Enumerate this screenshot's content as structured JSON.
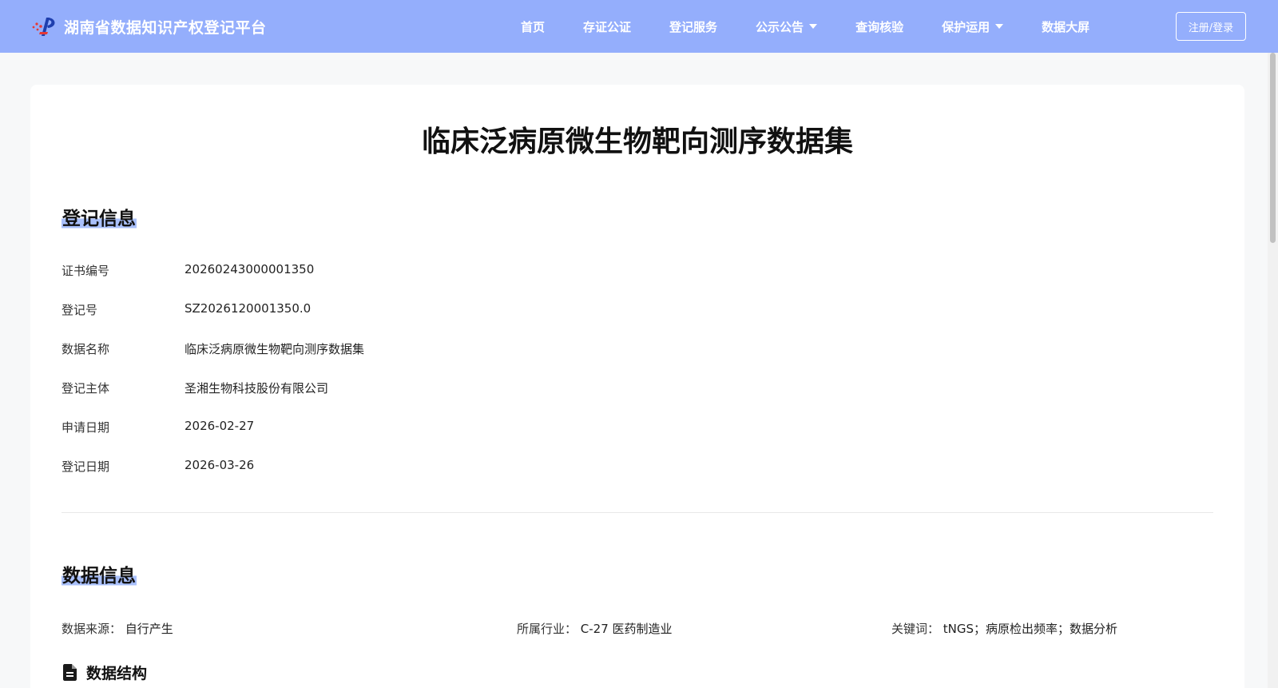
{
  "header": {
    "brand_title": "湖南省数据知识产权登记平台",
    "logo_icon": "platform-logo-icon",
    "nav": [
      {
        "label": "首页",
        "has_dropdown": false
      },
      {
        "label": "存证公证",
        "has_dropdown": false
      },
      {
        "label": "登记服务",
        "has_dropdown": false
      },
      {
        "label": "公示公告",
        "has_dropdown": true
      },
      {
        "label": "查询核验",
        "has_dropdown": false
      },
      {
        "label": "保护运用",
        "has_dropdown": true
      },
      {
        "label": "数据大屏",
        "has_dropdown": false
      }
    ],
    "login_label": "注册/登录",
    "bg_color": "#94aefc"
  },
  "page": {
    "title": "临床泛病原微生物靶向测序数据集"
  },
  "registration": {
    "section_title": "登记信息",
    "rows": [
      {
        "label": "证书编号",
        "value": "20260243000001350"
      },
      {
        "label": "登记号",
        "value": "SZ2026120001350.0"
      },
      {
        "label": "数据名称",
        "value": "临床泛病原微生物靶向测序数据集"
      },
      {
        "label": "登记主体",
        "value": "圣湘生物科技股份有限公司"
      },
      {
        "label": "申请日期",
        "value": "2026-02-27"
      },
      {
        "label": "登记日期",
        "value": "2026-03-26"
      }
    ]
  },
  "data_info": {
    "section_title": "数据信息",
    "source": {
      "label": "数据来源：",
      "value": "自行产生"
    },
    "industry": {
      "label": "所属行业：",
      "value": "C-27 医药制造业"
    },
    "keywords": {
      "label": "关键词：",
      "value": "tNGS；病原检出频率；数据分析"
    },
    "structure_title": "数据结构",
    "structure_icon": "document-icon"
  },
  "colors": {
    "accent": "#94aefc",
    "highlight": "#a9c0fb"
  }
}
